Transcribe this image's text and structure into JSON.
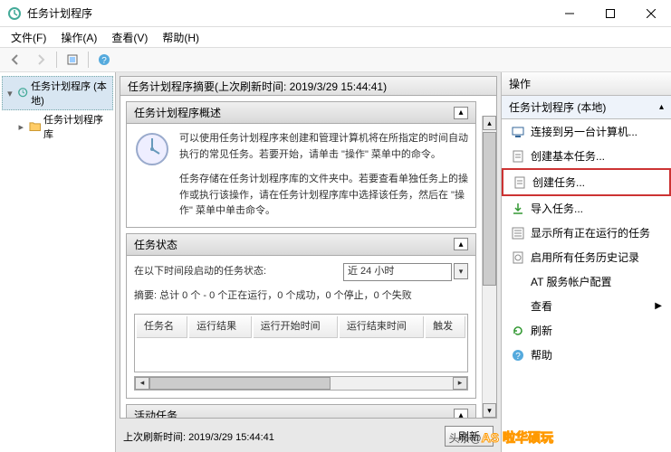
{
  "window": {
    "title": "任务计划程序"
  },
  "menu": {
    "file": "文件(F)",
    "action": "操作(A)",
    "view": "查看(V)",
    "help": "帮助(H)"
  },
  "tree": {
    "root": "任务计划程序 (本地)",
    "child": "任务计划程序库"
  },
  "summary": {
    "header": "任务计划程序摘要(上次刷新时间: 2019/3/29 15:44:41)",
    "overview_title": "任务计划程序概述",
    "overview_p1": "可以使用任务计划程序来创建和管理计算机将在所指定的时间自动执行的常见任务。若要开始，请单击 \"操作\" 菜单中的命令。",
    "overview_p2": "任务存储在任务计划程序库的文件夹中。若要查看单独任务上的操作或执行该操作，请在任务计划程序库中选择该任务，然后在 \"操作\" 菜单中单击命令。",
    "status_title": "任务状态",
    "status_label": "在以下时间段启动的任务状态:",
    "status_combo": "近 24 小时",
    "status_summary": "摘要: 总计 0 个 - 0 个正在运行，0 个成功，0 个停止，0 个失败",
    "table_cols": {
      "name": "任务名",
      "result": "运行结果",
      "start": "运行开始时间",
      "end": "运行结束时间",
      "trigger": "触发"
    },
    "active_title": "活动任务",
    "footer_time": "上次刷新时间: 2019/3/29 15:44:41",
    "refresh_btn": "刷新"
  },
  "actions": {
    "header": "操作",
    "context": "任务计划程序 (本地)",
    "items": [
      {
        "label": "连接到另一台计算机...",
        "icon": "computer"
      },
      {
        "label": "创建基本任务...",
        "icon": "task"
      },
      {
        "label": "创建任务...",
        "icon": "task",
        "highlight": true
      },
      {
        "label": "导入任务...",
        "icon": "import"
      },
      {
        "label": "显示所有正在运行的任务",
        "icon": "list"
      },
      {
        "label": "启用所有任务历史记录",
        "icon": "history"
      },
      {
        "label": "AT 服务帐户配置",
        "icon": ""
      },
      {
        "label": "查看",
        "icon": "",
        "submenu": true
      },
      {
        "label": "刷新",
        "icon": "refresh"
      },
      {
        "label": "帮助",
        "icon": "help"
      }
    ]
  },
  "watermark": {
    "pre": "头条@",
    "text": "AS 啦华硕玩"
  }
}
